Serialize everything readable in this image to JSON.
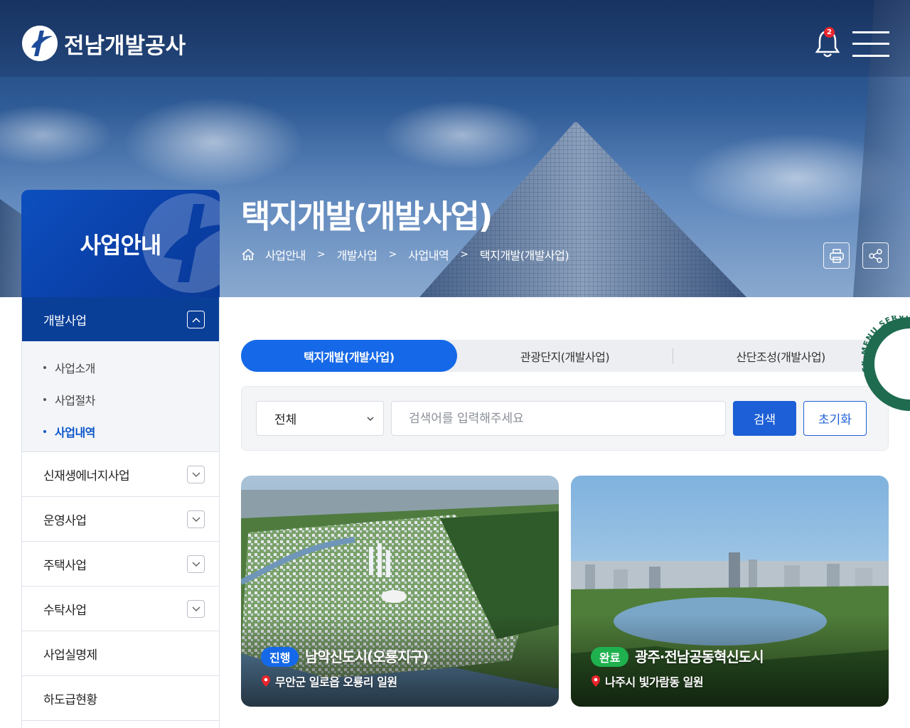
{
  "header": {
    "logo_text": "전남개발공사",
    "notification_count": "2",
    "colors": {
      "brand_blue": "#0a3f98",
      "accent_blue": "#1569e8"
    }
  },
  "hero": {
    "title": "택지개발(개발사업)",
    "breadcrumb": [
      "사업안내",
      "개발사업",
      "사업내역",
      "택지개발(개발사업)"
    ],
    "actions": {
      "print_icon": "print-icon",
      "share_icon": "share-icon"
    }
  },
  "sidebar": {
    "title": "사업안내",
    "items": [
      {
        "label": "개발사업",
        "expanded": true
      },
      {
        "label": "신재생에너지사업"
      },
      {
        "label": "운영사업"
      },
      {
        "label": "주택사업"
      },
      {
        "label": "수탁사업"
      },
      {
        "label": "사업실명제"
      },
      {
        "label": "하도급현황"
      }
    ],
    "subitems": [
      "사업소개",
      "사업절차",
      "사업내역"
    ]
  },
  "tabs": [
    {
      "label": "택지개발(개발사업)",
      "active": true
    },
    {
      "label": "관광단지(개발사업)"
    },
    {
      "label": "산단조성(개발사업)"
    }
  ],
  "search": {
    "select_value": "전체",
    "placeholder": "검색어를 입력해주세요",
    "search_label": "검색",
    "reset_label": "초기화"
  },
  "cards": [
    {
      "status": "진행",
      "status_color": "#1569e8",
      "title": "남악신도시(오룡지구)",
      "location": "무안군 일로읍 오룡리 일원"
    },
    {
      "status": "완료",
      "status_color": "#1fb14f",
      "title": "광주·전남공동혁신도시",
      "location": "나주시 빛가람동 일원"
    }
  ],
  "quick_menu": {
    "label": "QUICK MENU SERVICE"
  }
}
